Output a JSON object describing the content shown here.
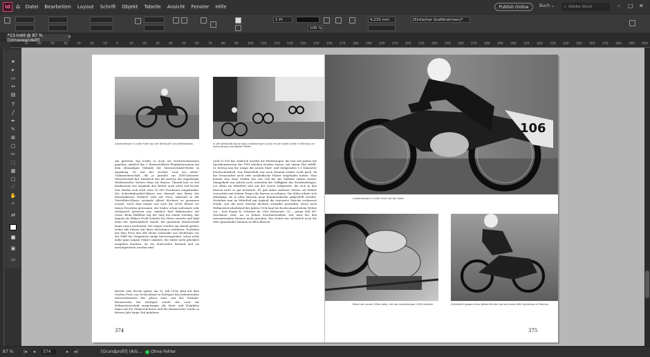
{
  "app": {
    "logo": "Id",
    "window_title": "*13.indd @ 87 % [Umgewandelt]"
  },
  "menu": [
    "Datei",
    "Bearbeiten",
    "Layout",
    "Schrift",
    "Objekt",
    "Tabelle",
    "Ansicht",
    "Fenster",
    "Hilfe"
  ],
  "topbar": {
    "publish": "Publish Online",
    "workspace": "Buch ⌄",
    "search_placeholder": "Adobe Stock"
  },
  "control": {
    "stroke_weight": "1 Pt",
    "size": "4,233 mm",
    "zoom_pct": "100 %",
    "style_select": "[Einfacher Grafikrahmen]*"
  },
  "ruler_ticks": [
    "70",
    "60",
    "50",
    "40",
    "30",
    "20",
    "10",
    "0",
    "10",
    "20",
    "30",
    "40",
    "50",
    "60",
    "70",
    "80",
    "90",
    "100",
    "110",
    "120",
    "130",
    "140",
    "150",
    "160",
    "170",
    "180",
    "190",
    "200",
    "210",
    "220",
    "230",
    "240",
    "250",
    "260",
    "270",
    "280",
    "290",
    "300",
    "310",
    "320",
    "330",
    "340",
    "350",
    "360",
    "370",
    "380",
    "390",
    "400",
    "410"
  ],
  "page_left": {
    "caption_1": "Leistenberger in voller Fahrt auf der Wertig BF zum Wettbewerb.",
    "caption_2": "In der Werkstatt-Kurve ging Leistenberger (Lauf) mit der Adler sofort in Führung vor Georg Braun und Walter Pfeifer.",
    "col1": "Am gleichen Tag lockte es auch ein Nachwuchsrennen gegeben, nämlich das 2. Rasenstelleitet Flughafenrennen auf dem ehemaligen Gelände der Messerschmitt-Werke in Augsburg. Es war der sechste Lauf zur ADAC-Clubmeisterschaft, die ja parallel zur DMV-Junioren-Meisterschaft lief. Natürlich war die Anreise der Augsburger Wettbewerber Werner Haas als Starter. Überall hier so viel Konkurrenz wie nirgends das Wetter auch nicht viel besser war, fanden sich doch etwa 30 000 Zuschauer eingefunden. Die Achtzehnhundert-Klasse war diesmal eine Beute des Einsatzfahrers Herbert Löbl auf Puch, während in der Viertelliter-Klasse erstmals Alfred Wöchner zu gewinnen wusste. Nach dem Sieger war auch die 350er Klasse vor einem Favoriten gewonnen, der bisher schon mehrmals sehr erfolgreich gewesen war, nämlich Karl Einkenscher auf Guzzi. Beim Halbliter lag der Sieg bei einem Neuling, der damals als Pfälzer Fredl Schmitt für Gilera startete und bald einer der Spitzenfahrer wurde, der gesamten Fahrerschaft kaum etwas nachstand. Die Sieger wurden am Abend geehrt, wobei alle Fahrer mit ihren Maschinen vorfuhren. Nachdem mit dem Preis den alle Heinz Schneider aus Niedernau vor der DKW bis Gangstrom einige hervorragenden, schon nicht mehr ganz jungen Fahrer nämlich, die leider nicht glücklich ausgehen konnten, da ein Startverbot bestand und sie zurückgetreten worden sind.",
    "col2": "Bereits eine Woche später, am 25. Juli 1954, fand mit dem Großen Preis von Deutschland in Stuttgart das bedeutendste Motorradrennen des Jahres statt. Auf der Solitude-Rennstrecke bei Stuttgart wurde der Lauf zur Weltmeisterschaft ausgetragen, die Start- und Zielplätze lagen auf der Glemseck-Kurve und die Rennstrecke wurde in diesem Jahr lange Zeit gefahren.",
    "page_number": "374"
  },
  "page_right": {
    "col": "rund 10 000 km. Dadurch wurden die Förderungen: die erst seit Jahren die Sportkommission der FIM erhoben worden waren, mit einem Mal erfüllt. So betrug nun die Länge der neuen Start- und Zielgeraden 1,5 Kilometer durchschnittlich. Das Fahrerfeld war auch diesmal wieder recht groß, da die Veranstalter auch viele ausländische Fahrer eingeladen hatten. Man konnte also ohne Gefahr das Gas voll bis zur Ziellinie stehen lassen. Mangelhaft war jedoch noch weiterhin die Griffigkeit des Straßenbelages, vor allem im Mittelteil und auf der neuen Zielgerade, die sich in den Kurven nicht so gut bewährte. Es gab daher mehrere Stürze, als Fahrer versuchten mit hohem Tempo die Kurven zu nehmen. Die Mühe lohnte sich allerdings, da in allen Klassen neue Rundenrekorde aufgestellt wurden. Nachdem nun im Mittelteil mit Asphalt die erneuerte Strecke verbessert wurde, war die neue Strecke deutlich schneller geworden. Diese noch Weltmeisterschaftslauf des Jahres 1954 fand bei hochsommerlichem Wetter vor – laut Eugen K. Schwarz im »Das Motorrad« (1) – genau 434 567 Zuschauer statt. An so hohen Zuschauerzahlen war man bei den internationalen Rennen nicht gewöhnt. Ein Grund war sicherlich auch die sehr spannenden Rennen in allen Klassen.",
    "cap_big": "Leistenberger in voller Fahrt auf der Adler.",
    "cap_bl": "Motor der neuen 250er Adler, mit der Leistenberger 1954 startete.",
    "cap_br": "Schließlich gewann Alex Weber-Richter auf der neuen NSU-Sportmax im Rennen.",
    "page_number": "375"
  },
  "status": {
    "zoom": "87 %",
    "page": "374",
    "profile": "[Grundprofil] (Arb…",
    "preflight": "Ohne Fehler"
  },
  "colors": {
    "accent": "#e3457a",
    "ok": "#2fbf4a"
  }
}
